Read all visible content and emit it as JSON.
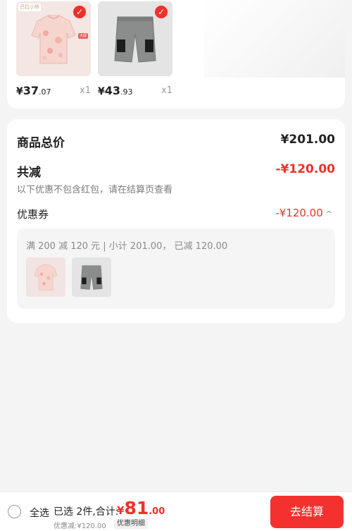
{
  "selected_items": [
    {
      "brand_tag": "巴拉小熊",
      "promo_tag": "大促",
      "price_yen": "¥",
      "price_int": "37",
      "price_dec": ".07",
      "qty": "x1",
      "image": "pink-floral-top"
    },
    {
      "price_yen": "¥",
      "price_int": "43",
      "price_dec": ".93",
      "qty": "x1",
      "image": "grey-cargo-shorts"
    }
  ],
  "summary": {
    "goods_total_label": "商品总价",
    "goods_total_value": "¥201.00",
    "reduce_label": "共减",
    "reduce_value": "-¥120.00",
    "note": "以下优惠不包含红包，请在结算页查看",
    "coupon_label": "优惠券",
    "coupon_value": "-¥120.00",
    "coupon_desc": "满 200 减 120 元 | 小计 201.00， 已减 120.00"
  },
  "bottom_bar": {
    "select_all": "全选",
    "chosen_text": "已选 2件,合计:",
    "total_yen": "¥",
    "total_int": "81",
    "total_dec": ".00",
    "discount_text": "优惠减:¥120.00",
    "detail_label": "优惠明细",
    "checkout_label": "去结算"
  },
  "colors": {
    "accent": "#f0312a",
    "checkout_bg": "#f5312f"
  }
}
